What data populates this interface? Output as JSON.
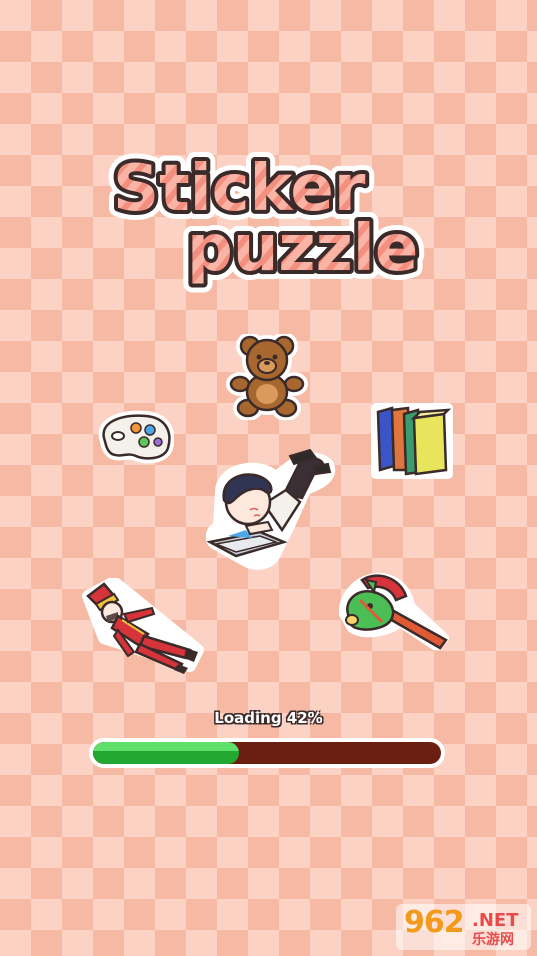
{
  "game": {
    "title_line1": "Sticker",
    "title_line2": "puzzle"
  },
  "loading": {
    "label": "Loading 42%",
    "progress": 0.42
  },
  "stickers": [
    {
      "name": "teddy-bear-icon"
    },
    {
      "name": "paint-palette-icon"
    },
    {
      "name": "books-icon"
    },
    {
      "name": "boy-reading-icon"
    },
    {
      "name": "toy-soldier-icon"
    },
    {
      "name": "hobby-horse-icon"
    }
  ],
  "watermark": {
    "number": "962",
    "net": ".NET",
    "cn": "乐游网"
  },
  "colors": {
    "background_light": "#fbd2c3",
    "background_dark": "#f6b9a4",
    "title_fill": "#f7a99a",
    "bar_fill": "#30c040",
    "bar_track": "#6b1f10"
  }
}
